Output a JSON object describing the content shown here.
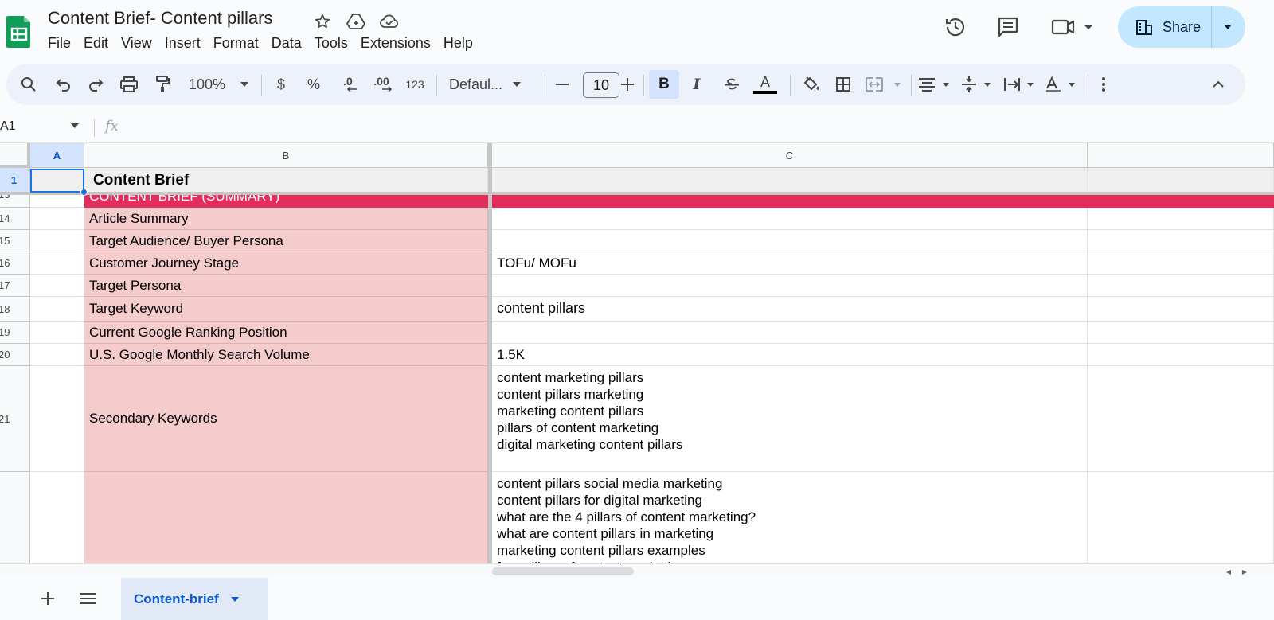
{
  "app": {
    "doc_title": "Content Brief- Content pillars",
    "menu": [
      "File",
      "Edit",
      "View",
      "Insert",
      "Format",
      "Data",
      "Tools",
      "Extensions",
      "Help"
    ],
    "share_label": "Share",
    "brand_color": "#0f9d58"
  },
  "toolbar": {
    "zoom": "100%",
    "currency": "$",
    "percent": "%",
    "decrease_decimal": ".0",
    "increase_decimal": ".00",
    "number_format": "123",
    "font": "Defaul...",
    "font_size": "10",
    "bold": "B",
    "italic": "I",
    "text_color_letter": "A"
  },
  "formula_bar": {
    "name_box": "A1",
    "fx": "fx",
    "content": ""
  },
  "grid": {
    "columns": [
      "A",
      "B",
      "C"
    ],
    "selected_cell": "A1",
    "frozen_row": {
      "row": "1",
      "a": "",
      "b": "Content Brief",
      "c": ""
    },
    "band_row": {
      "row": "13",
      "b": "CONTENT BRIEF (SUMMARY)",
      "color": "#e32d5c"
    },
    "rows": [
      {
        "row": "14",
        "b": "Article Summary",
        "c": ""
      },
      {
        "row": "15",
        "b": "Target Audience/ Buyer Persona",
        "c": ""
      },
      {
        "row": "16",
        "b": "Customer Journey Stage",
        "c": "TOFu/ MOFu"
      },
      {
        "row": "17",
        "b": "Target Persona",
        "c": ""
      },
      {
        "row": "18",
        "b": "Target Keyword",
        "c": "content pillars"
      },
      {
        "row": "19",
        "b": "Current Google Ranking Position",
        "c": ""
      },
      {
        "row": "20",
        "b": "U.S. Google Monthly Search Volume",
        "c": "1.5K"
      },
      {
        "row": "21",
        "b": "Secondary Keywords",
        "c": "content marketing pillars\ncontent pillars marketing\nmarketing content pillars\npillars of content marketing\ndigital marketing content pillars"
      },
      {
        "row": "",
        "b": "",
        "c": "content pillars social media marketing\ncontent pillars for digital marketing\nwhat are the 4 pillars of content marketing?\nwhat are content pillars in marketing\nmarketing content pillars examples\nfour pillars of content marketing"
      }
    ],
    "label_fill": "#f4cccc"
  },
  "sheets": {
    "active_tab": "Content-brief"
  }
}
